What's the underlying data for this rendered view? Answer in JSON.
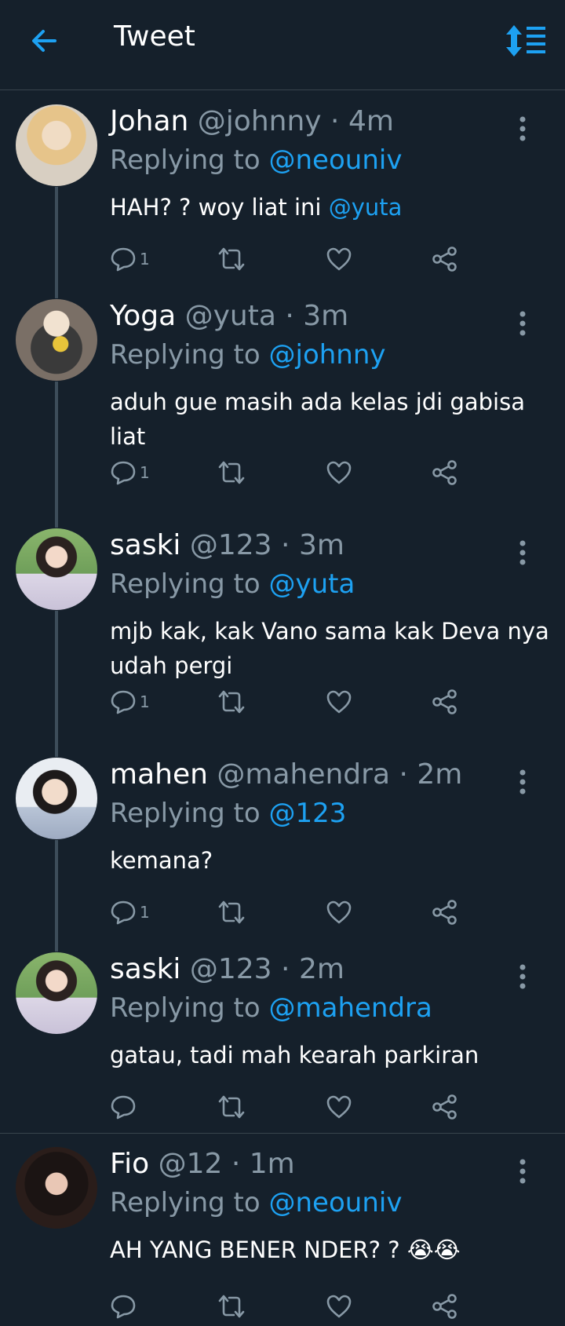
{
  "header": {
    "title": "Tweet",
    "back_icon": "arrow-left-icon",
    "sort_icon": "sort-icon",
    "accent": "#1da1f2"
  },
  "colors": {
    "background": "#15202b",
    "muted": "#8899a6",
    "accent": "#1da1f2",
    "divider": "#38444d"
  },
  "tweets": [
    {
      "name": "Johan",
      "handle": "@johnny",
      "time": "4m",
      "reply_prefix": "Replying to",
      "reply_to": "@neouniv",
      "text": "HAH? ?  woy liat ini ",
      "text_mention": "@yuta",
      "reply_count": "1"
    },
    {
      "name": "Yoga",
      "handle": "@yuta",
      "time": "3m",
      "reply_prefix": "Replying to",
      "reply_to": "@johnny",
      "text": "aduh gue masih ada kelas jdi gabisa liat",
      "reply_count": "1"
    },
    {
      "name": "saski",
      "handle": "@123",
      "time": "3m",
      "reply_prefix": "Replying to",
      "reply_to": "@yuta",
      "text": "mjb kak,  kak Vano sama kak Deva nya udah pergi",
      "reply_count": "1"
    },
    {
      "name": "mahen",
      "handle": "@mahendra",
      "time": "2m",
      "reply_prefix": "Replying to",
      "reply_to": "@123",
      "text": "kemana?",
      "reply_count": "1"
    },
    {
      "name": "saski",
      "handle": "@123",
      "time": "2m",
      "reply_prefix": "Replying to",
      "reply_to": "@mahendra",
      "text": "gatau,  tadi mah kearah parkiran",
      "reply_count": ""
    },
    {
      "name": "Fio",
      "handle": "@12",
      "time": "1m",
      "reply_prefix": "Replying to",
      "reply_to": "@neouniv",
      "text": "AH YANG BENER NDER? ?  😭😭",
      "reply_count": ""
    }
  ],
  "separator": "·"
}
